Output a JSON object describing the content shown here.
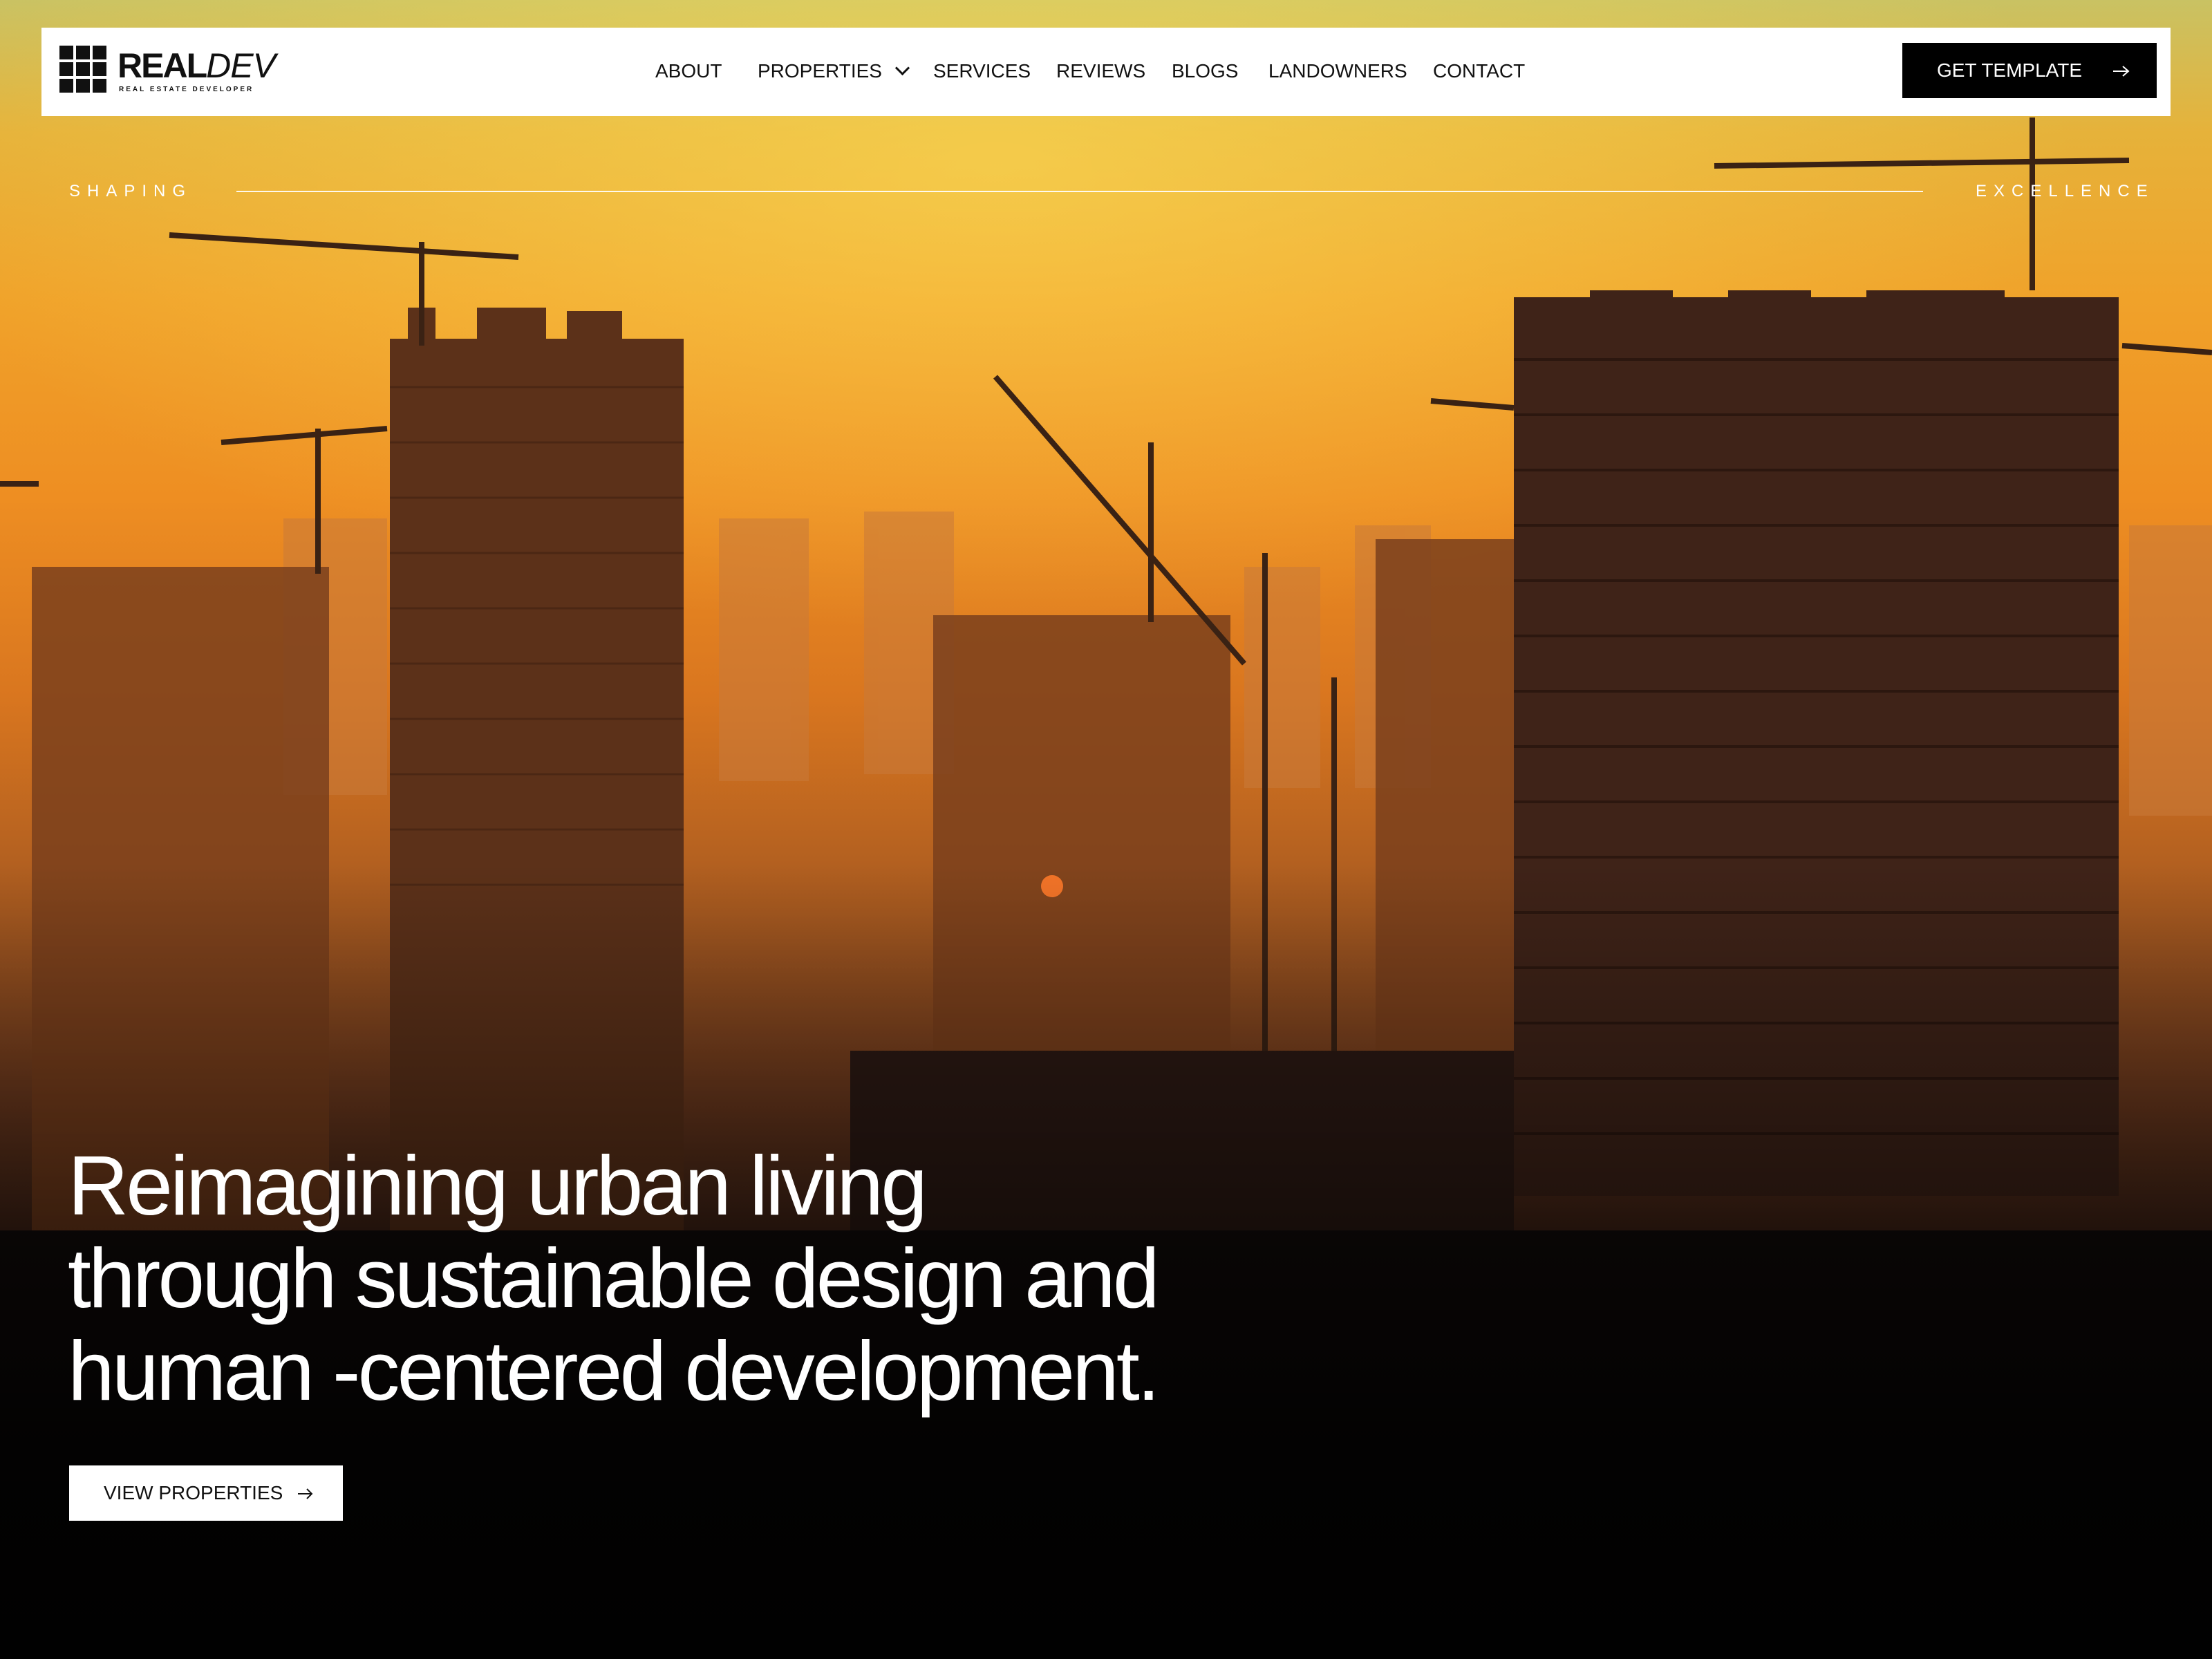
{
  "brand": {
    "name_bold": "REAL",
    "name_light": "DEV",
    "tagline": "REAL ESTATE DEVELOPER"
  },
  "nav": {
    "items": [
      {
        "label": "ABOUT"
      },
      {
        "label": "PROPERTIES",
        "has_dropdown": true
      },
      {
        "label": "SERVICES"
      },
      {
        "label": "REVIEWS"
      },
      {
        "label": "BLOGS"
      },
      {
        "label": "LANDOWNERS"
      },
      {
        "label": "CONTACT"
      }
    ],
    "cta_label": "GET TEMPLATE",
    "cta_icon": "arrow-right-icon"
  },
  "hero": {
    "tagline_left": "SHAPING",
    "tagline_right": "EXCELLENCE",
    "headline_lines": [
      "Reimagining urban living",
      "through sustainable design and",
      "human -centered development."
    ],
    "button_label": "VIEW PROPERTIES",
    "button_icon": "arrow-right-icon",
    "background_description_colors": {
      "sky_top": "#c9c263",
      "sky_mid": "#f0a22a",
      "sky_low": "#d9761f",
      "ground": "#0a0909"
    }
  },
  "colors": {
    "navbar_bg": "#ffffff",
    "cta_bg": "#000000",
    "cta_text": "#ffffff",
    "text_dark": "#111111",
    "text_light": "#ffffff"
  }
}
